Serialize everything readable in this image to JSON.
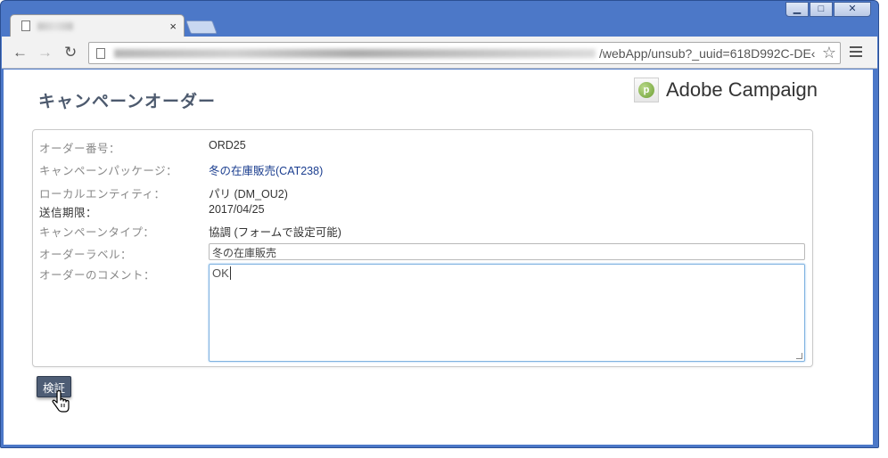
{
  "browser": {
    "tab_close": "×",
    "url_visible": "/webApp/unsub?_uuid=618D992C-DE‹",
    "window_controls": {
      "minimize": "▁",
      "maximize": "□",
      "close": "✕"
    },
    "nav": {
      "back": "←",
      "forward": "→",
      "reload": "↻",
      "star": "☆"
    }
  },
  "page": {
    "title": "キャンペーンオーダー",
    "brand": {
      "name": "Adobe Campaign",
      "logo_letter": "p"
    }
  },
  "form": {
    "order_number": {
      "label": "オーダー番号：",
      "value": "ORD25"
    },
    "package": {
      "label": "キャンペーンパッケージ：",
      "value": "冬の在庫販売(CAT238)"
    },
    "local_entity": {
      "label": "ローカルエンティティ：",
      "value": "パリ (DM_OU2)"
    },
    "deadline": {
      "label": "送信期限：",
      "value": "2017/04/25"
    },
    "campaign_type": {
      "label": "キャンペーンタイプ：",
      "value": "協調 (フォームで設定可能)"
    },
    "order_label": {
      "label": "オーダーラベル：",
      "value": "冬の在庫販売"
    },
    "order_comment": {
      "label": "オーダーのコメント：",
      "value": "OK"
    }
  },
  "actions": {
    "validate_label": "検証"
  },
  "colors": {
    "window_frame": "#4c78c8",
    "title": "#4d5a6e",
    "link": "#1a3d8f",
    "button": "#4e5d75"
  }
}
